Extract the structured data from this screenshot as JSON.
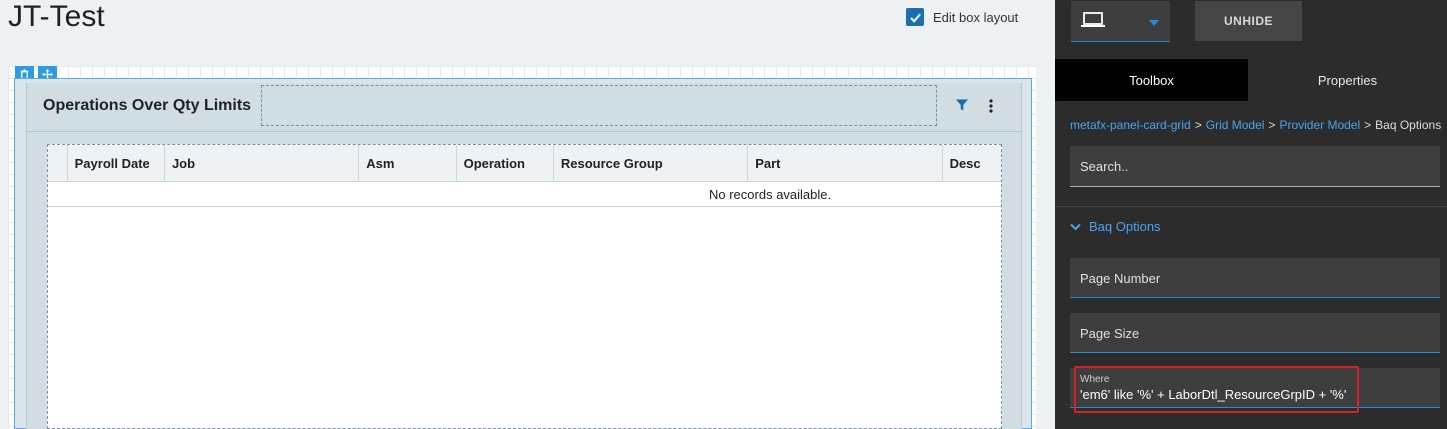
{
  "page": {
    "title": "JT-Test"
  },
  "edit_layout": {
    "label": "Edit box layout",
    "checked": true
  },
  "card": {
    "title": "Operations Over Qty Limits"
  },
  "grid": {
    "columns": [
      "",
      "Payroll Date",
      "Job",
      "Asm",
      "Operation",
      "Resource Group",
      "Part",
      "Desc"
    ],
    "empty_message": "No records available."
  },
  "panel": {
    "unhide_label": "UNHIDE",
    "tabs": [
      {
        "label": "Toolbox",
        "active": true
      },
      {
        "label": "Properties",
        "active": false
      }
    ],
    "breadcrumb": [
      "metafx-panel-card-grid",
      "Grid Model",
      "Provider Model",
      "Baq Options"
    ],
    "search_placeholder": "Search..",
    "section_title": "Baq Options",
    "fields": {
      "page_number": "Page Number",
      "page_size": "Page Size",
      "where_label": "Where",
      "where_value": "'em6' like '%' + LaborDtl_ResourceGrpID + '%'"
    }
  },
  "colors": {
    "accent": "#1e90e0",
    "link": "#4aa3f0",
    "highlight": "#d9202a",
    "panel_bg": "#2c2c2c"
  },
  "icons": [
    "check-icon",
    "trash-icon",
    "move-icon",
    "filter-icon",
    "kebab-icon",
    "laptop-icon",
    "caret-down-icon",
    "chevron-down-icon"
  ]
}
